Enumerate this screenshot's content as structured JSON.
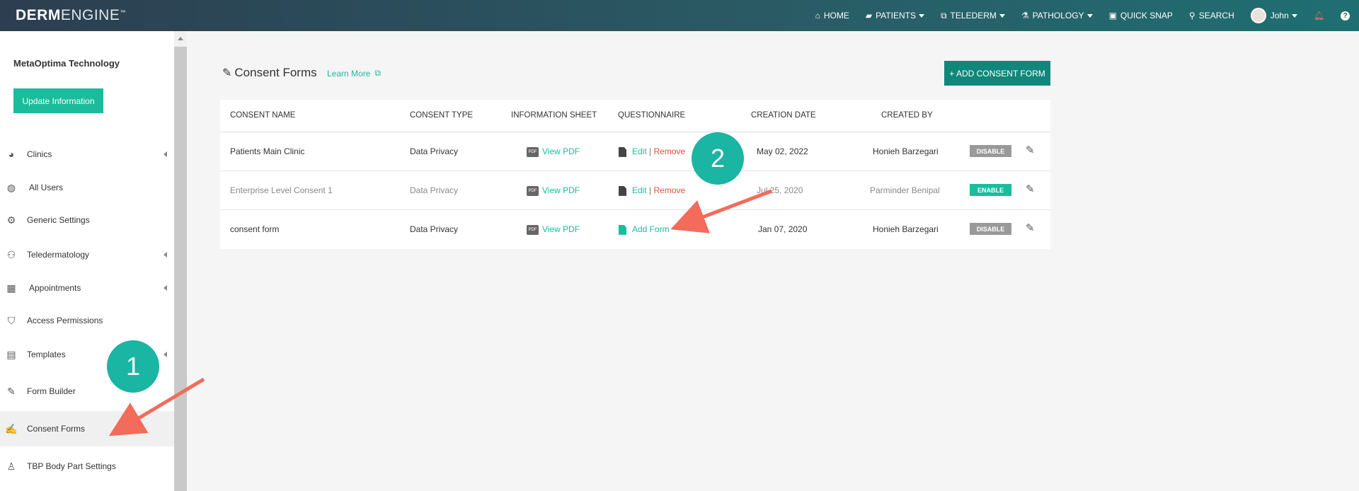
{
  "topbar": {
    "logo_bold": "DERM",
    "logo_light": "ENGINE",
    "logo_tm": "™",
    "nav": {
      "home": "HOME",
      "patients": "PATIENTS",
      "telederm": "TELEDERM",
      "pathology": "PATHOLOGY",
      "quick_snap": "QUICK SNAP",
      "search": "SEARCH",
      "user": "John"
    }
  },
  "sidebar": {
    "org_name": "MetaOptima Technology",
    "update_button": "Update Information",
    "items": [
      {
        "label": "Clinics",
        "icon": "pie-chart-icon"
      },
      {
        "label": "All Users",
        "icon": "globe-icon"
      },
      {
        "label": "Generic Settings",
        "icon": "gear-icon"
      },
      {
        "label": "Teledermatology",
        "icon": "users-icon"
      },
      {
        "label": "Appointments",
        "icon": "calendar-icon"
      },
      {
        "label": "Access Permissions",
        "icon": "shield-icon"
      },
      {
        "label": "Templates",
        "icon": "document-icon"
      },
      {
        "label": "Form Builder",
        "icon": "form-edit-icon"
      },
      {
        "label": "Consent Forms",
        "icon": "consent-edit-icon"
      },
      {
        "label": "TBP Body Part Settings",
        "icon": "body-icon"
      }
    ]
  },
  "main": {
    "title": "Consent Forms",
    "learn_more": "Learn More",
    "add_button": "+ ADD CONSENT FORM",
    "columns": [
      "CONSENT NAME",
      "CONSENT TYPE",
      "INFORMATION SHEET",
      "QUESTIONNAIRE",
      "CREATION DATE",
      "CREATED BY"
    ],
    "rows": [
      {
        "name": "Patients Main Clinic",
        "type": "Data Privacy",
        "info": "View PDF",
        "q_edit": "Edit",
        "q_sep": "|",
        "q_remove": "Remove",
        "date": "May 02, 2022",
        "by": "Honieh Barzegari",
        "status": "DISABLE"
      },
      {
        "name": "Enterprise Level Consent 1",
        "type": "Data Privacy",
        "info": "View PDF",
        "q_edit": "Edit",
        "q_sep": "|",
        "q_remove": "Remove",
        "date": "Jul 25, 2020",
        "by": "Parminder Benipal",
        "status": "ENABLE"
      },
      {
        "name": "consent form",
        "type": "Data Privacy",
        "info": "View PDF",
        "q_add": "Add Form",
        "date": "Jan 07, 2020",
        "by": "Honieh Barzegari",
        "status": "DISABLE"
      }
    ]
  },
  "annotations": {
    "badge_1": "1",
    "badge_2": "2",
    "arrow_color": "#f26b5b"
  },
  "colors": {
    "accent": "#1abc9c",
    "add_button": "#10877a",
    "remove": "#e74c3c"
  }
}
